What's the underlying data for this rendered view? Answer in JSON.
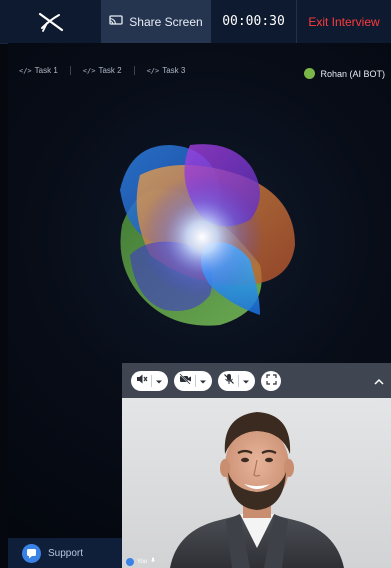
{
  "topbar": {
    "logo_icon": "plane-logo-icon",
    "share_label": "Share Screen",
    "timer": "00:00:30",
    "exit_label": "Exit Interview"
  },
  "tasks": [
    {
      "icon": "</>",
      "label": "Task 1"
    },
    {
      "icon": "</>",
      "label": "Task 2"
    },
    {
      "icon": "</>",
      "label": "Task 3"
    }
  ],
  "bot": {
    "name": "Rohan (AI BOT)",
    "status_color": "#7ab648"
  },
  "support": {
    "label": "Support"
  },
  "video": {
    "you_label": "You"
  },
  "colors": {
    "exit": "#ff3b3b",
    "accent": "#3b82e6",
    "topbar": "#0e1a30"
  }
}
